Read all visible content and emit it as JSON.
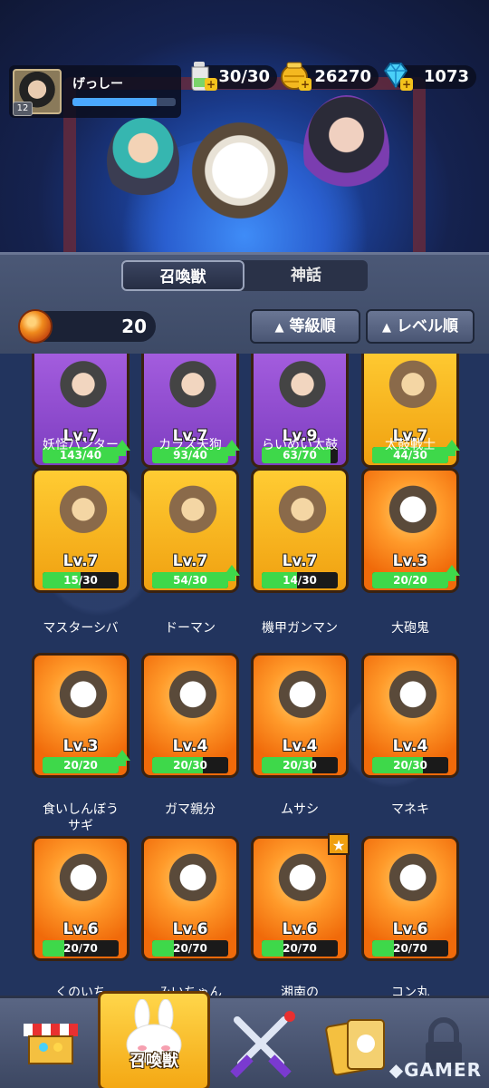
{
  "player": {
    "name": "げっしー",
    "level": "12",
    "xp_fraction": 0.82
  },
  "resources": {
    "stamina": "30/30",
    "gold": "26270",
    "gems": "1073"
  },
  "tabs": {
    "summon_beasts": "召喚獣",
    "mythology": "神話"
  },
  "orbs": {
    "count": "20"
  },
  "sort": {
    "grade": "等級順",
    "level": "レベル順",
    "arrow": "▲"
  },
  "cards": [
    {
      "name": "妖怪ハンター",
      "level": "Lv.7",
      "progress": "143/40",
      "rarity": "purple",
      "fill": 1,
      "up": true
    },
    {
      "name": "カラス天狗",
      "level": "Lv.7",
      "progress": "93/40",
      "rarity": "purple",
      "fill": 1,
      "up": true
    },
    {
      "name": "らいめい太鼓",
      "level": "Lv.9",
      "progress": "63/70",
      "rarity": "purple",
      "fill": 0.9,
      "up": false
    },
    {
      "name": "太鼓戦士",
      "level": "Lv.7",
      "progress": "44/30",
      "rarity": "gold",
      "fill": 1,
      "up": true
    },
    {
      "name": "マスターシバ",
      "level": "Lv.7",
      "progress": "15/30",
      "rarity": "gold",
      "fill": 0.5,
      "up": false
    },
    {
      "name": "ドーマン",
      "level": "Lv.7",
      "progress": "54/30",
      "rarity": "gold",
      "fill": 1,
      "up": true
    },
    {
      "name": "機甲ガンマン",
      "level": "Lv.7",
      "progress": "14/30",
      "rarity": "gold",
      "fill": 0.47,
      "up": false
    },
    {
      "name": "大砲鬼",
      "level": "Lv.3",
      "progress": "20/20",
      "rarity": "orange",
      "fill": 1,
      "up": true
    },
    {
      "name": "食いしんぼう\nサギ",
      "level": "Lv.3",
      "progress": "20/20",
      "rarity": "orange",
      "fill": 1,
      "up": true
    },
    {
      "name": "ガマ親分",
      "level": "Lv.4",
      "progress": "20/30",
      "rarity": "orange",
      "fill": 0.67,
      "up": false
    },
    {
      "name": "ムサシ",
      "level": "Lv.4",
      "progress": "20/30",
      "rarity": "orange",
      "fill": 0.67,
      "up": false
    },
    {
      "name": "マネキ",
      "level": "Lv.4",
      "progress": "20/30",
      "rarity": "orange",
      "fill": 0.67,
      "up": false
    },
    {
      "name": "くのいち\nエイカ",
      "level": "Lv.6",
      "progress": "20/70",
      "rarity": "orange",
      "fill": 0.29,
      "up": false
    },
    {
      "name": "みいちゃん",
      "level": "Lv.6",
      "progress": "20/70",
      "rarity": "orange",
      "fill": 0.29,
      "up": false
    },
    {
      "name": "湘南の\nショウタ",
      "level": "Lv.6",
      "progress": "20/70",
      "rarity": "orange",
      "fill": 0.29,
      "up": false,
      "star": true
    },
    {
      "name": "コン丸",
      "level": "Lv.6",
      "progress": "20/70",
      "rarity": "orange",
      "fill": 0.29,
      "up": false
    }
  ],
  "nav": {
    "summon_label": "召喚獣"
  },
  "watermark": "GAMER"
}
